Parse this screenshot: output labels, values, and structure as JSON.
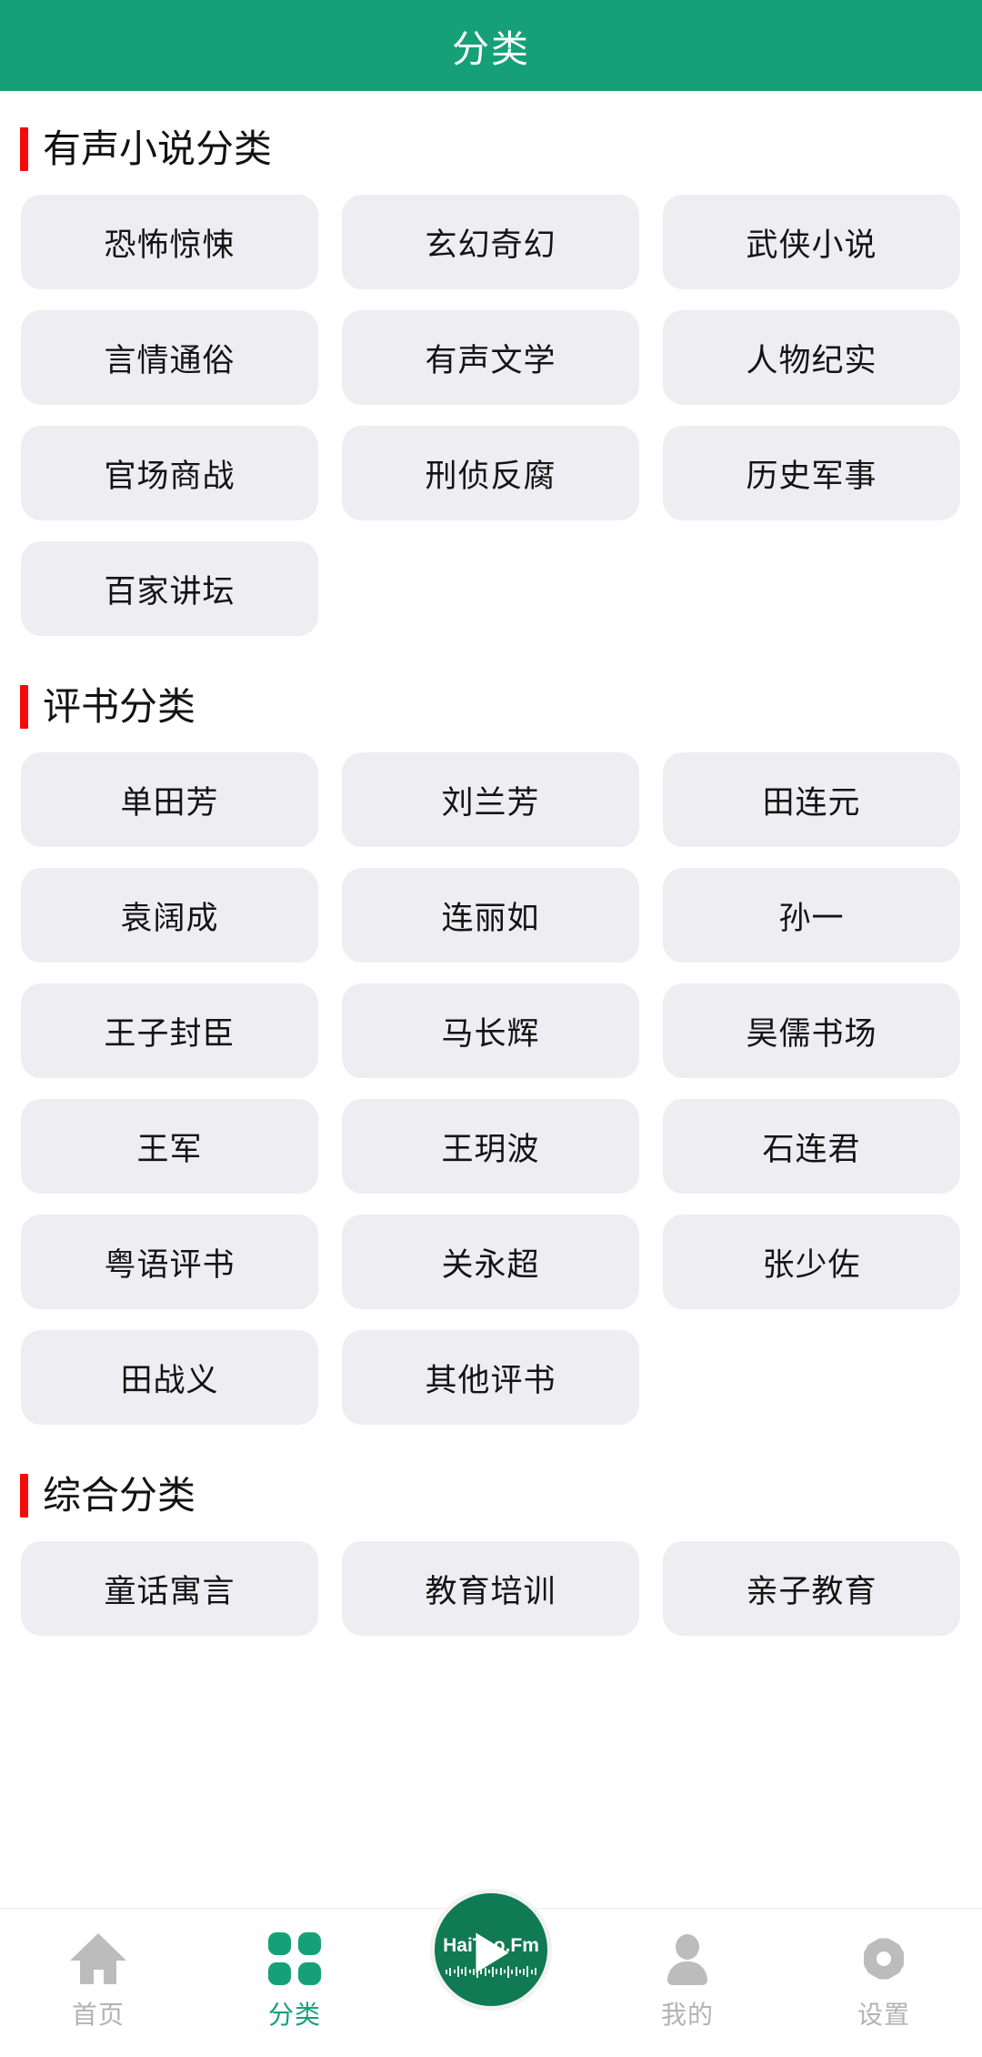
{
  "header": {
    "title": "分类"
  },
  "sections": [
    {
      "title": "有声小说分类",
      "items": [
        "恐怖惊悚",
        "玄幻奇幻",
        "武侠小说",
        "言情通俗",
        "有声文学",
        "人物纪实",
        "官场商战",
        "刑侦反腐",
        "历史军事",
        "百家讲坛"
      ]
    },
    {
      "title": "评书分类",
      "items": [
        "单田芳",
        "刘兰芳",
        "田连元",
        "袁阔成",
        "连丽如",
        "孙一",
        "王子封臣",
        "马长辉",
        "昊儒书场",
        "王军",
        "王玥波",
        "石连君",
        "粤语评书",
        "关永超",
        "张少佐",
        "田战义",
        "其他评书"
      ]
    },
    {
      "title": "综合分类",
      "items": [
        "童话寓言",
        "教育培训",
        "亲子教育"
      ]
    }
  ],
  "tabbar": {
    "items": [
      {
        "label": "首页",
        "icon": "home-icon",
        "active": false
      },
      {
        "label": "分类",
        "icon": "grid-icon",
        "active": true
      },
      {
        "label": "我的",
        "icon": "person-icon",
        "active": false
      },
      {
        "label": "设置",
        "icon": "gear-icon",
        "active": false
      }
    ],
    "play_button": {
      "wordmark": "HaiTao.Fm",
      "icon": "play-icon"
    }
  },
  "colors": {
    "brand_green": "#16a077",
    "fab_green": "#0f7a53",
    "accent_red": "#f40b0b",
    "chip_bg": "#eeeef2",
    "inactive_gray": "#b3b3b3"
  }
}
